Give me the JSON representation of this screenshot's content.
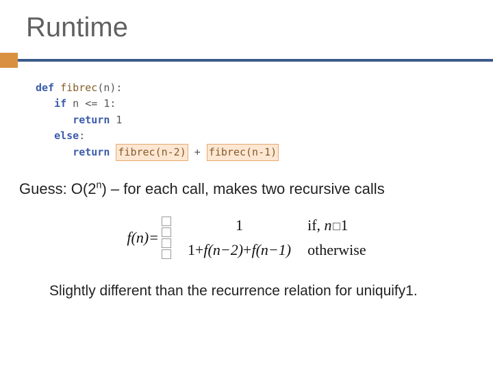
{
  "title": "Runtime",
  "code": {
    "def": "def",
    "fn_name": "fibrec",
    "param_open": "(n):",
    "if_kw": "if",
    "cond": " n <= 1:",
    "return_kw": "return",
    "one": "1",
    "else_kw": "else",
    "colon": ":",
    "call1": "fibrec(n-2)",
    "plus": " + ",
    "call2": "fibrec(n-1)"
  },
  "guess": {
    "prefix": "Guess: O(2",
    "sup": "n",
    "suffix": ") – for each call, makes two recursive calls"
  },
  "formula": {
    "fn_eq": "f(n)=",
    "case1_mid": "1",
    "case1_right_prefix": "if, ",
    "case1_right_var": "n",
    "case1_right_suffix": "1",
    "case2_mid_prefix": "1+",
    "case2_mid_f1": "f(n−2)",
    "case2_mid_plus": "+",
    "case2_mid_f2": "f(n−1)",
    "case2_right": "otherwise"
  },
  "footnote": "Slightly different than the recurrence relation for uniquify1."
}
